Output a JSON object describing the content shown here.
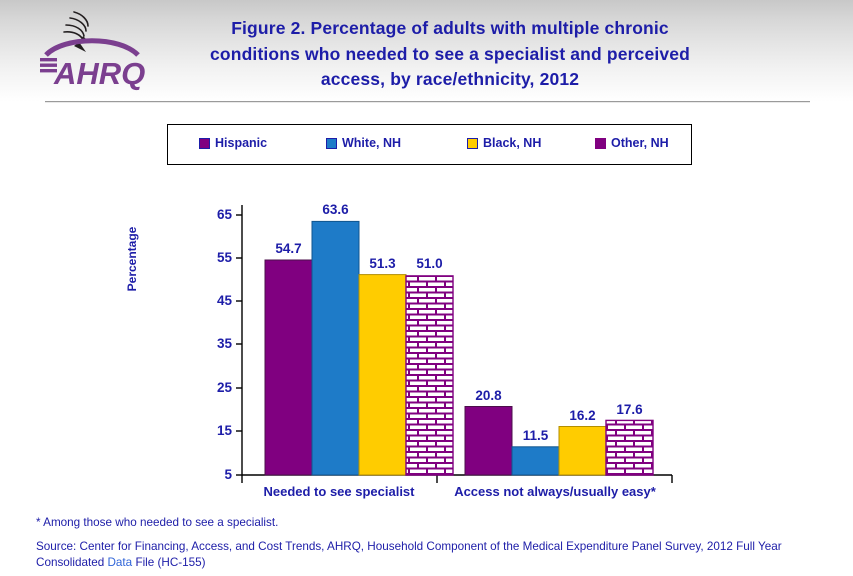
{
  "header": {
    "logo_alt": "AHRQ Agency for Healthcare Research and Quality",
    "logo_text": "AHRQ"
  },
  "title": "Figure 2. Percentage of adults with multiple chronic conditions who needed to see a specialist and perceived access, by race/ethnicity, 2012",
  "footnotes": {
    "asterisk": "* Among those who needed to see a specialist.",
    "source_part1": "Source: Center for Financing, Access, and Cost Trends, AHRQ, Household Component of the Medical Expenditure Panel Survey, 2012 Full Year Consolidated",
    "source_link": "Data",
    "source_part2": "File (HC-155)"
  },
  "colors": {
    "hispanic": "#800080",
    "white_nh": "#1E7BC8",
    "black_nh": "#FFCC00",
    "other_nh": "#FFFFFF",
    "other_nh_pattern": "#800080",
    "text_blue": "#1D1DA8",
    "axis": "#000000",
    "link_blue": "#2F64D8"
  },
  "chart_data": {
    "type": "bar",
    "title": "Figure 2. Percentage of adults with multiple chronic conditions who needed to see a specialist and perceived access, by race/ethnicity, 2012",
    "xlabel": "",
    "ylabel": "Percentage",
    "ylim": [
      5,
      70
    ],
    "yticks": [
      5,
      15,
      25,
      35,
      45,
      55,
      65
    ],
    "grid": false,
    "legend_position": "top",
    "categories": [
      "Needed to see specialist",
      "Access not always/usually easy*"
    ],
    "series": [
      {
        "name": "Hispanic",
        "values": [
          54.7,
          20.8
        ],
        "color": "#800080",
        "pattern": "solid"
      },
      {
        "name": "White, NH",
        "values": [
          63.6,
          11.5
        ],
        "color": "#1E7BC8",
        "pattern": "solid"
      },
      {
        "name": "Black, NH",
        "values": [
          51.3,
          16.2
        ],
        "color": "#FFCC00",
        "pattern": "solid"
      },
      {
        "name": "Other, NH",
        "values": [
          51.0,
          17.6
        ],
        "color": "#FFFFFF",
        "pattern": "brick"
      }
    ],
    "data_labels": [
      [
        "54.7",
        "63.6",
        "51.3",
        "51.0"
      ],
      [
        "20.8",
        "11.5",
        "16.2",
        "17.6"
      ]
    ]
  },
  "legend": {
    "items": [
      {
        "label": "Hispanic"
      },
      {
        "label": "White, NH"
      },
      {
        "label": "Black, NH"
      },
      {
        "label": "Other, NH"
      }
    ]
  },
  "axis": {
    "tick_labels": [
      "65",
      "55",
      "45",
      "35",
      "25",
      "15",
      "5"
    ],
    "y_title": "Percentage"
  }
}
